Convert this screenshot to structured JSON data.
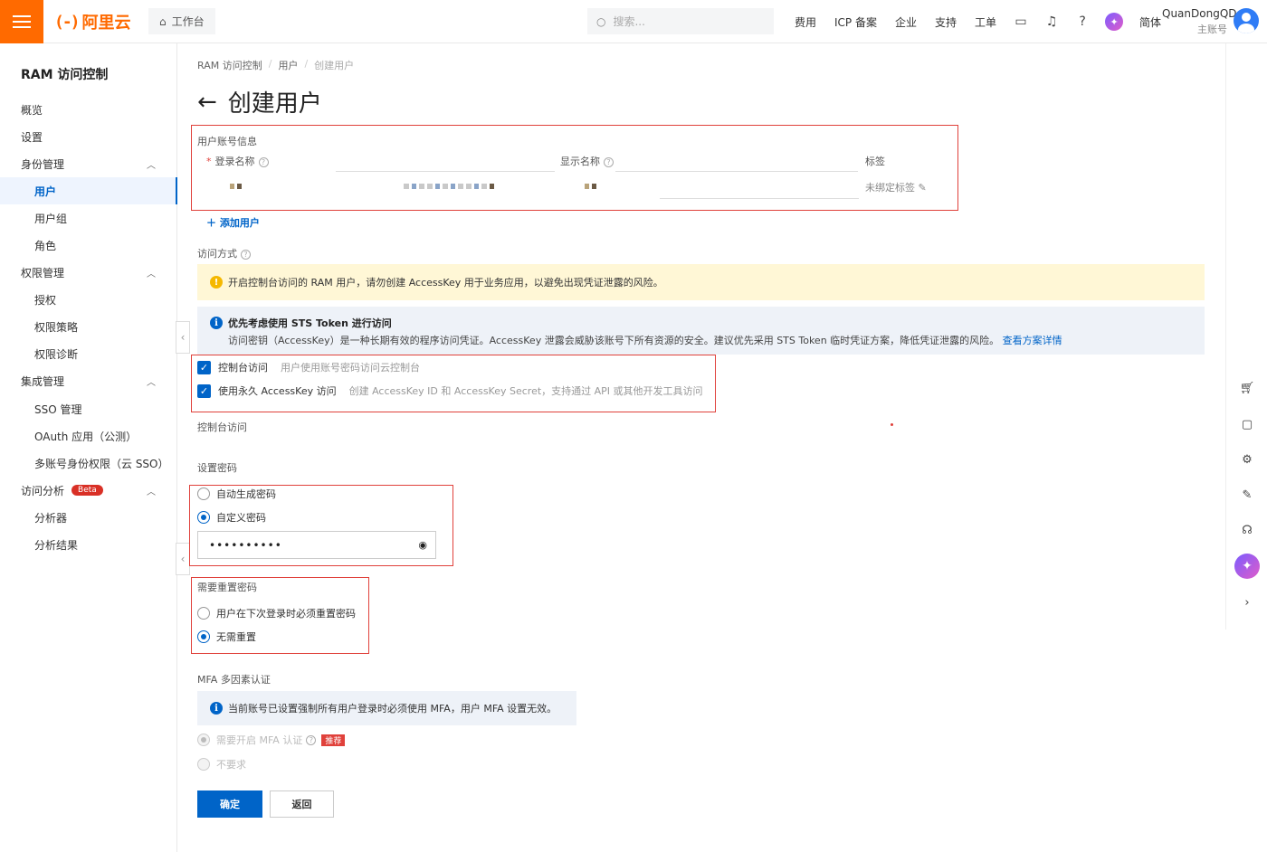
{
  "topbar": {
    "logo_mark": "(-)",
    "logo_text": "阿里云",
    "workbench": "工作台",
    "search_placeholder": "搜索...",
    "nav": [
      "费用",
      "ICP 备案",
      "企业",
      "支持",
      "工单"
    ],
    "lang": "简体",
    "user_name": "QuanDongQD",
    "user_role": "主账号"
  },
  "sidebar": {
    "title": "RAM 访问控制",
    "overview": "概览",
    "settings": "设置",
    "identity": "身份管理",
    "users": "用户",
    "groups": "用户组",
    "roles": "角色",
    "permissions": "权限管理",
    "grant": "授权",
    "policies": "权限策略",
    "diagnosis": "权限诊断",
    "integration": "集成管理",
    "sso": "SSO 管理",
    "oauth": "OAuth 应用（公测）",
    "multi_sso": "多账号身份权限（云 SSO）",
    "analysis": "访问分析",
    "beta": "Beta",
    "analyzer": "分析器",
    "results": "分析结果"
  },
  "breadcrumb": [
    "RAM 访问控制",
    "用户",
    "创建用户"
  ],
  "page_title": "创建用户",
  "account_section": {
    "title": "用户账号信息",
    "login_name_label": "登录名称",
    "display_name_label": "显示名称",
    "tags_label": "标签",
    "tags_value": "未绑定标签"
  },
  "add_user": "添加用户",
  "access": {
    "title": "访问方式",
    "warning": "开启控制台访问的 RAM 用户，请勿创建 AccessKey 用于业务应用，以避免出现凭证泄露的风险。",
    "info_title": "优先考虑使用 STS Token 进行访问",
    "info_desc": "访问密钥（AccessKey）是一种长期有效的程序访问凭证。AccessKey 泄露会威胁该账号下所有资源的安全。建议优先采用 STS Token 临时凭证方案，降低凭证泄露的风险。",
    "info_link": "查看方案详情",
    "console_label": "控制台访问",
    "console_desc": "用户使用账号密码访问云控制台",
    "ak_label": "使用永久 AccessKey 访问",
    "ak_desc": "创建 AccessKey ID 和 AccessKey Secret，支持通过 API 或其他开发工具访问"
  },
  "console_section": "控制台访问",
  "password": {
    "title": "设置密码",
    "auto": "自动生成密码",
    "custom": "自定义密码",
    "value": "••••••••••"
  },
  "reset": {
    "title": "需要重置密码",
    "must": "用户在下次登录时必须重置密码",
    "none": "无需重置"
  },
  "mfa": {
    "title": "MFA 多因素认证",
    "info": "当前账号已设置强制所有用户登录时必须使用 MFA，用户 MFA 设置无效。",
    "require": "需要开启 MFA 认证",
    "recommend": "推荐",
    "not_require": "不要求"
  },
  "buttons": {
    "confirm": "确定",
    "back": "返回"
  },
  "colors": {
    "brand": "#ff6a00",
    "primary": "#0064c8",
    "highlight": "#e0413b"
  }
}
